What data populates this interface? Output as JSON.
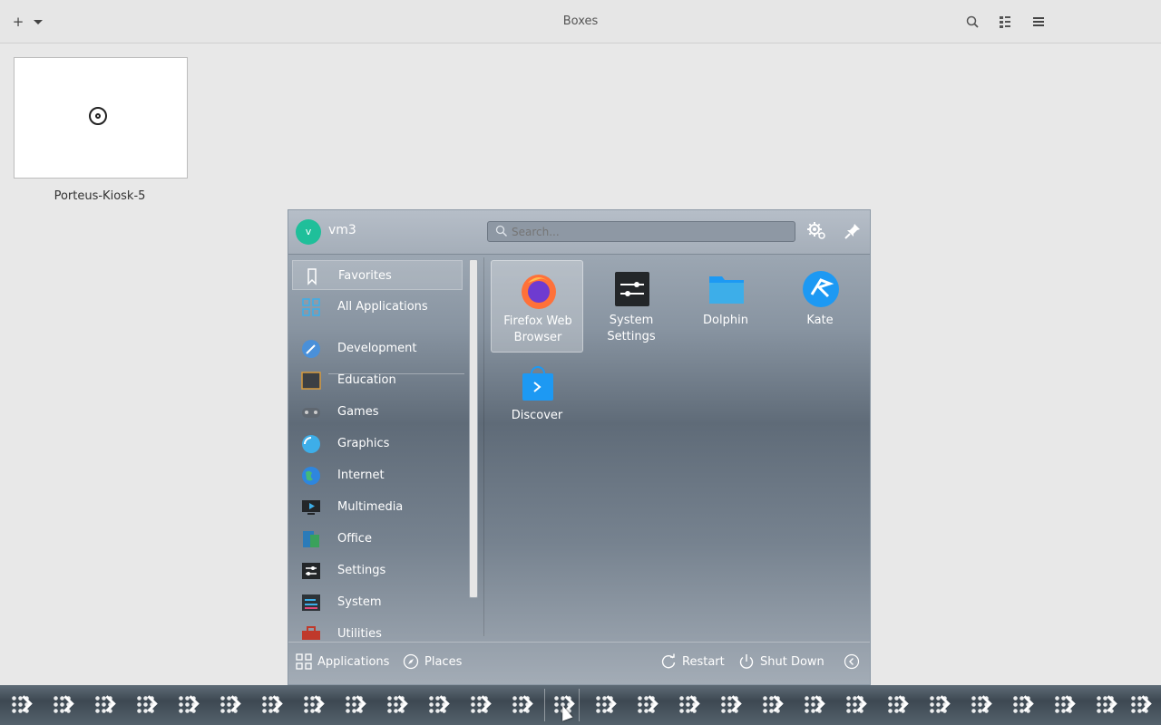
{
  "app": {
    "title": "Boxes",
    "new_button": "+",
    "vm": {
      "name": "Porteus-Kiosk-5"
    }
  },
  "launcher": {
    "user": {
      "avatar_letter": "v",
      "name": "vm3"
    },
    "search": {
      "placeholder": "Search..."
    },
    "sidebar": [
      {
        "label": "Favorites",
        "icon": "bookmark-icon",
        "selected": true
      },
      {
        "label": "All Applications",
        "icon": "grid-icon"
      },
      {
        "label": "Development",
        "icon": "development-icon"
      },
      {
        "label": "Education",
        "icon": "education-icon"
      },
      {
        "label": "Games",
        "icon": "gamepad-icon"
      },
      {
        "label": "Graphics",
        "icon": "graphics-icon"
      },
      {
        "label": "Internet",
        "icon": "globe-icon"
      },
      {
        "label": "Multimedia",
        "icon": "multimedia-icon"
      },
      {
        "label": "Office",
        "icon": "office-icon"
      },
      {
        "label": "Settings",
        "icon": "settings-icon"
      },
      {
        "label": "System",
        "icon": "system-icon"
      },
      {
        "label": "Utilities",
        "icon": "toolbox-icon"
      }
    ],
    "apps": [
      {
        "label": "Firefox Web Browser",
        "icon": "firefox-icon",
        "selected": true
      },
      {
        "label": "System Settings",
        "icon": "system-settings-icon"
      },
      {
        "label": "Dolphin",
        "icon": "folder-icon"
      },
      {
        "label": "Kate",
        "icon": "kate-icon"
      },
      {
        "label": "Discover",
        "icon": "discover-icon"
      }
    ],
    "footer": {
      "applications": "Applications",
      "places": "Places",
      "restart": "Restart",
      "shutdown": "Shut Down"
    }
  },
  "colors": {
    "accent_avatar": "#1fbf9a",
    "firefox": "#ff7139"
  }
}
